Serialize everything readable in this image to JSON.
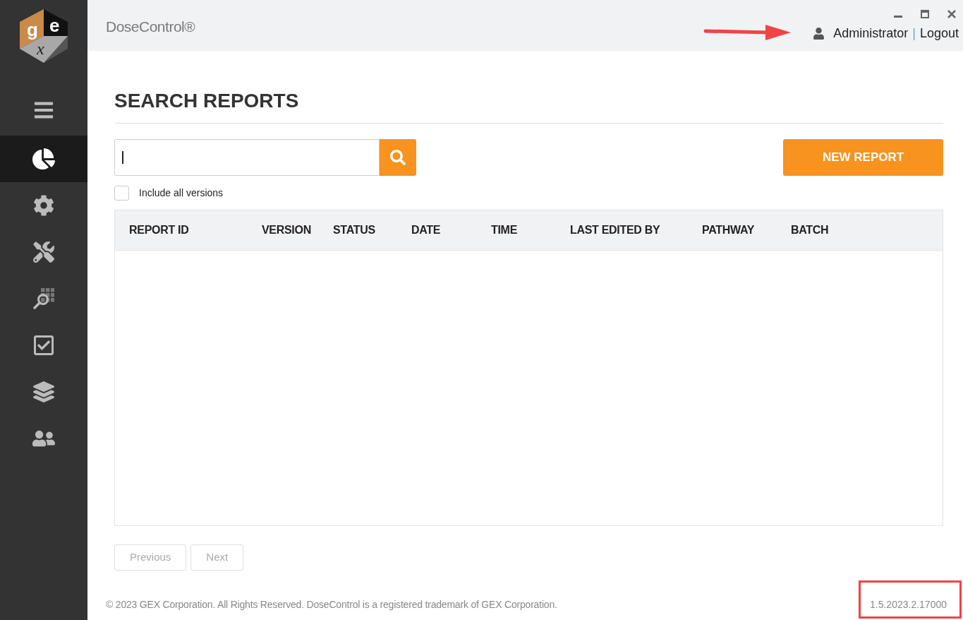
{
  "logo": {
    "letters": [
      "g",
      "e",
      "x"
    ]
  },
  "sidebar": {
    "items": [
      {
        "kind": "menu",
        "selected": false
      },
      {
        "kind": "reports",
        "selected": true
      },
      {
        "kind": "settings",
        "selected": false
      },
      {
        "kind": "tools",
        "selected": false
      },
      {
        "kind": "inspect",
        "selected": false
      },
      {
        "kind": "approvals",
        "selected": false
      },
      {
        "kind": "layers",
        "selected": false
      },
      {
        "kind": "users",
        "selected": false
      }
    ]
  },
  "header": {
    "app_title": "DoseControl®",
    "user": "Administrator",
    "separator": "|",
    "logout": "Logout"
  },
  "page": {
    "title": "SEARCH REPORTS",
    "new_button": "NEW REPORT",
    "include_all_versions": {
      "label": "Include all versions",
      "checked": false
    }
  },
  "table": {
    "columns": [
      "REPORT ID",
      "VERSION",
      "STATUS",
      "DATE",
      "TIME",
      "LAST EDITED BY",
      "PATHWAY",
      "BATCH"
    ]
  },
  "pagination": {
    "previous": {
      "label": "Previous",
      "disabled": true
    },
    "next": {
      "label": "Next",
      "disabled": true
    }
  },
  "footer": {
    "copyright": "© 2023 GEX Corporation. All Rights Reserved. DoseControl is a registered trademark of GEX Corporation.",
    "version": "1.5.2023.2.17000"
  },
  "annotations": {
    "arrow": true,
    "highlight_version": true
  }
}
